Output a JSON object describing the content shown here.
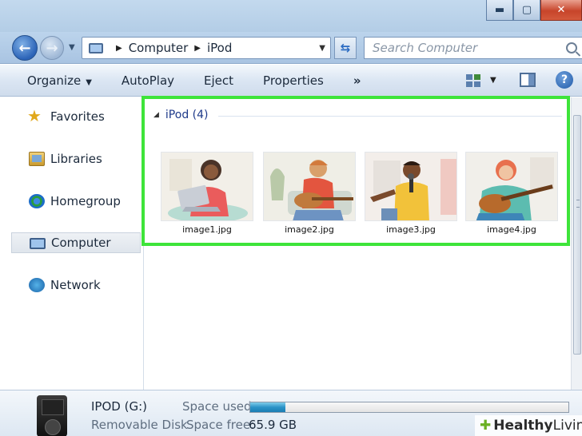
{
  "window": {
    "controls": {
      "minimize": "▬",
      "maximize": "▢",
      "close": "✕"
    }
  },
  "address": {
    "crumbs": [
      "Computer",
      "iPod"
    ],
    "search_placeholder": "Search Computer"
  },
  "toolbar": {
    "organize": "Organize",
    "autoplay": "AutoPlay",
    "eject": "Eject",
    "properties": "Properties",
    "more": "»",
    "help": "?"
  },
  "sidebar": {
    "items": [
      {
        "label": "Favorites",
        "icon": "star-icon"
      },
      {
        "label": "Libraries",
        "icon": "libraries-icon"
      },
      {
        "label": "Homegroup",
        "icon": "homegroup-icon"
      },
      {
        "label": "Computer",
        "icon": "computer-icon",
        "selected": true
      },
      {
        "label": "Network",
        "icon": "network-icon"
      }
    ]
  },
  "content": {
    "group_header": "iPod (4)",
    "files": [
      {
        "name": "image1.jpg"
      },
      {
        "name": "image2.jpg"
      },
      {
        "name": "image3.jpg"
      },
      {
        "name": "image4.jpg"
      }
    ]
  },
  "details": {
    "name": "IPOD (G:)",
    "type": "Removable Disk",
    "space_used_label": "Space used:",
    "space_free_label": "Space free:",
    "space_free_value": "65.9 GB",
    "used_fraction": 0.11
  },
  "watermark": {
    "leaf": "✚",
    "brand_bold": "Healthy",
    "brand_rest": "Living"
  },
  "colors": {
    "highlight": "#3ee43a",
    "group_header": "#1e3a8a",
    "usage_fill": "#2b93c7"
  }
}
